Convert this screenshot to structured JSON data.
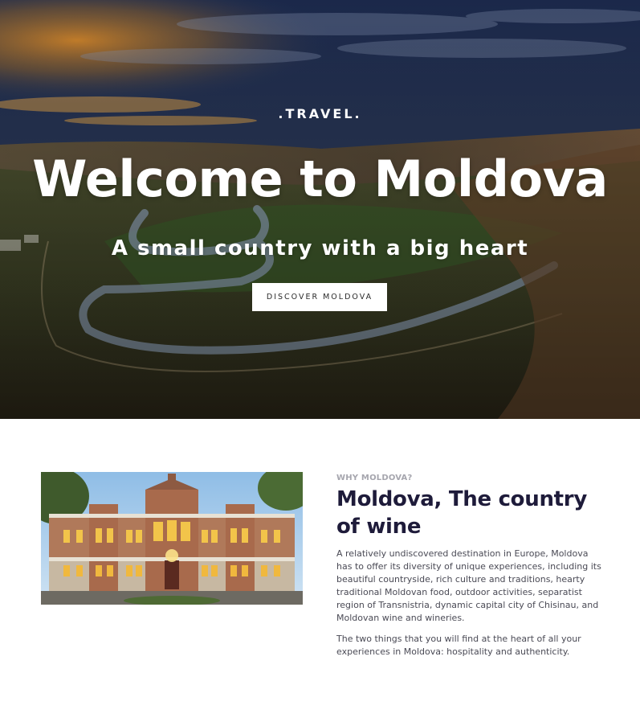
{
  "hero": {
    "eyebrow": ".TRAVEL.",
    "title": "Welcome to Moldova",
    "subtitle": "A small country with a big heart",
    "button_label": "DISCOVER MOLDOVA"
  },
  "about": {
    "eyebrow": "WHY MOLDOVA?",
    "title": "Moldova, The country of wine",
    "paragraph_1": "A relatively undiscovered destination in Europe, Moldova has to offer its diversity of unique experiences, including its beautiful countryside, rich culture and traditions, hearty traditional Moldovan food, outdoor activities, separatist region of Transnistria, dynamic capital city of Chisinau, and Moldovan wine and wineries.",
    "paragraph_2": "The two things that you will find at the heart of all your experiences in Moldova: hospitality and authenticity."
  },
  "colors": {
    "heading": "#1e1b3a",
    "eyebrow": "#a6a6ae",
    "body_text": "#4a4a55",
    "button_bg": "#ffffff"
  }
}
